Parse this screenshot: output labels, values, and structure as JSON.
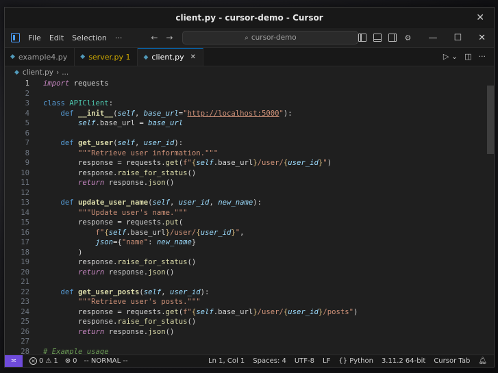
{
  "window": {
    "title": "client.py - cursor-demo - Cursor"
  },
  "menu": {
    "items": [
      "File",
      "Edit",
      "Selection",
      "···"
    ]
  },
  "search": {
    "text": "cursor-demo"
  },
  "tabs": [
    {
      "label": "example4.py"
    },
    {
      "label": "server.py 1"
    },
    {
      "label": "client.py"
    }
  ],
  "breadcrumb": {
    "file": "client.py",
    "rest": "..."
  },
  "code": [
    {
      "n": "1"
    },
    {
      "n": "2"
    },
    {
      "n": "3"
    },
    {
      "n": "4"
    },
    {
      "n": "5"
    },
    {
      "n": "6"
    },
    {
      "n": "7"
    },
    {
      "n": "8"
    },
    {
      "n": "9"
    },
    {
      "n": "10"
    },
    {
      "n": "11"
    },
    {
      "n": "12"
    },
    {
      "n": "13"
    },
    {
      "n": "14"
    },
    {
      "n": "15"
    },
    {
      "n": "16"
    },
    {
      "n": "17"
    },
    {
      "n": "18"
    },
    {
      "n": "19"
    },
    {
      "n": "20"
    },
    {
      "n": "21"
    },
    {
      "n": "22"
    },
    {
      "n": "23"
    },
    {
      "n": "24"
    },
    {
      "n": "25"
    },
    {
      "n": "26"
    },
    {
      "n": "27"
    },
    {
      "n": "28"
    }
  ],
  "status": {
    "errors": "0",
    "warnings": "1",
    "ports": "0",
    "mode": "-- NORMAL --",
    "position": "Ln 1, Col 1",
    "spaces": "Spaces: 4",
    "encoding": "UTF-8",
    "eol": "LF",
    "language": "Python",
    "interpreter": "3.11.2 64-bit",
    "cursor_tab": "Cursor Tab"
  },
  "colors": {
    "accent": "#0078d4",
    "remote": "#6f4bdb",
    "keyword": "#569cd6",
    "function": "#dcdcaa",
    "string": "#ce9178",
    "class": "#4ec9b0"
  }
}
